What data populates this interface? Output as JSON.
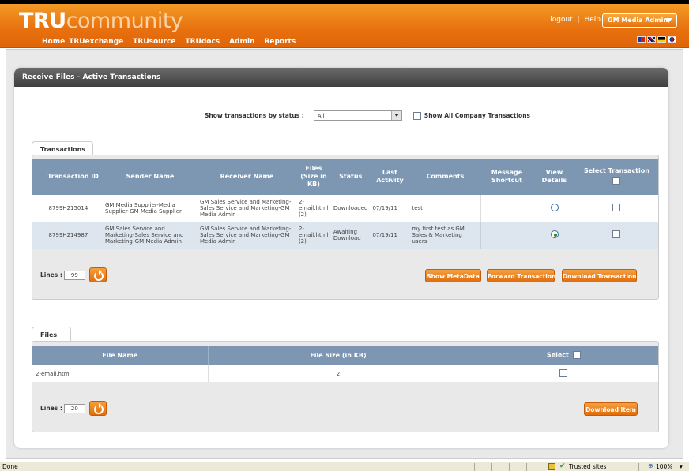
{
  "header": {
    "logo_tru": "TRU",
    "logo_rest": "community",
    "nav": [
      "Home",
      "TRUexchange",
      "TRUsource",
      "TRUdocs",
      "Admin",
      "Reports"
    ],
    "logout": "logout",
    "separator": "|",
    "help": "Help",
    "user_menu": "GM Media Admin"
  },
  "panel": {
    "title": "Receive Files - Active Transactions"
  },
  "filter": {
    "label": "Show transactions by status :",
    "status_value": "All",
    "company_label": "Show All Company Transactions"
  },
  "transactions": {
    "tab": "Transactions",
    "columns": [
      "Transaction ID",
      "Sender Name",
      "Receiver Name",
      "Files (Size in KB)",
      "Status",
      "Last Activity",
      "Comments",
      "Message Shortcut",
      "View Details",
      "Select Transaction"
    ],
    "rows": [
      {
        "id": "8799H215014",
        "sender": "GM Media Supplier-Media Supplier-GM Media Supplier",
        "receiver": "GM Sales Service and Marketing-Sales Service and Marketing-GM Media Admin",
        "files": "2-email.html (2)",
        "status": "Downloaded",
        "last_activity": "07/19/11",
        "comments": "test",
        "shortcut": "",
        "selected_view": false
      },
      {
        "id": "8799H214987",
        "sender": "GM Sales Service and Marketing-Sales Service and Marketing-GM Media Admin",
        "receiver": "GM Sales Service and Marketing-Sales Service and Marketing-GM Media Admin",
        "files": "2-email.html (2)",
        "status": "Awaiting Download",
        "last_activity": "07/19/11",
        "comments": "my first test as GM Sales & Marketing users",
        "shortcut": "",
        "selected_view": true
      }
    ],
    "lines_label": "Lines :",
    "lines_value": "99",
    "buttons": {
      "metadata": "Show MetaData",
      "forward": "Forward Transaction",
      "download": "Download Transaction"
    }
  },
  "files": {
    "tab": "Files",
    "columns": [
      "File Name",
      "File Size (in KB)",
      "Select"
    ],
    "rows": [
      {
        "name": "2-email.html",
        "size": "2"
      }
    ],
    "lines_label": "Lines :",
    "lines_value": "20",
    "download_button": "Download Item"
  },
  "statusbar": {
    "left": "Done",
    "zone": "Trusted sites",
    "zoom": "100%"
  },
  "colors": {
    "header_orange": "#e8720c",
    "table_header": "#7d97b3",
    "button_orange": "#e26c0b"
  }
}
